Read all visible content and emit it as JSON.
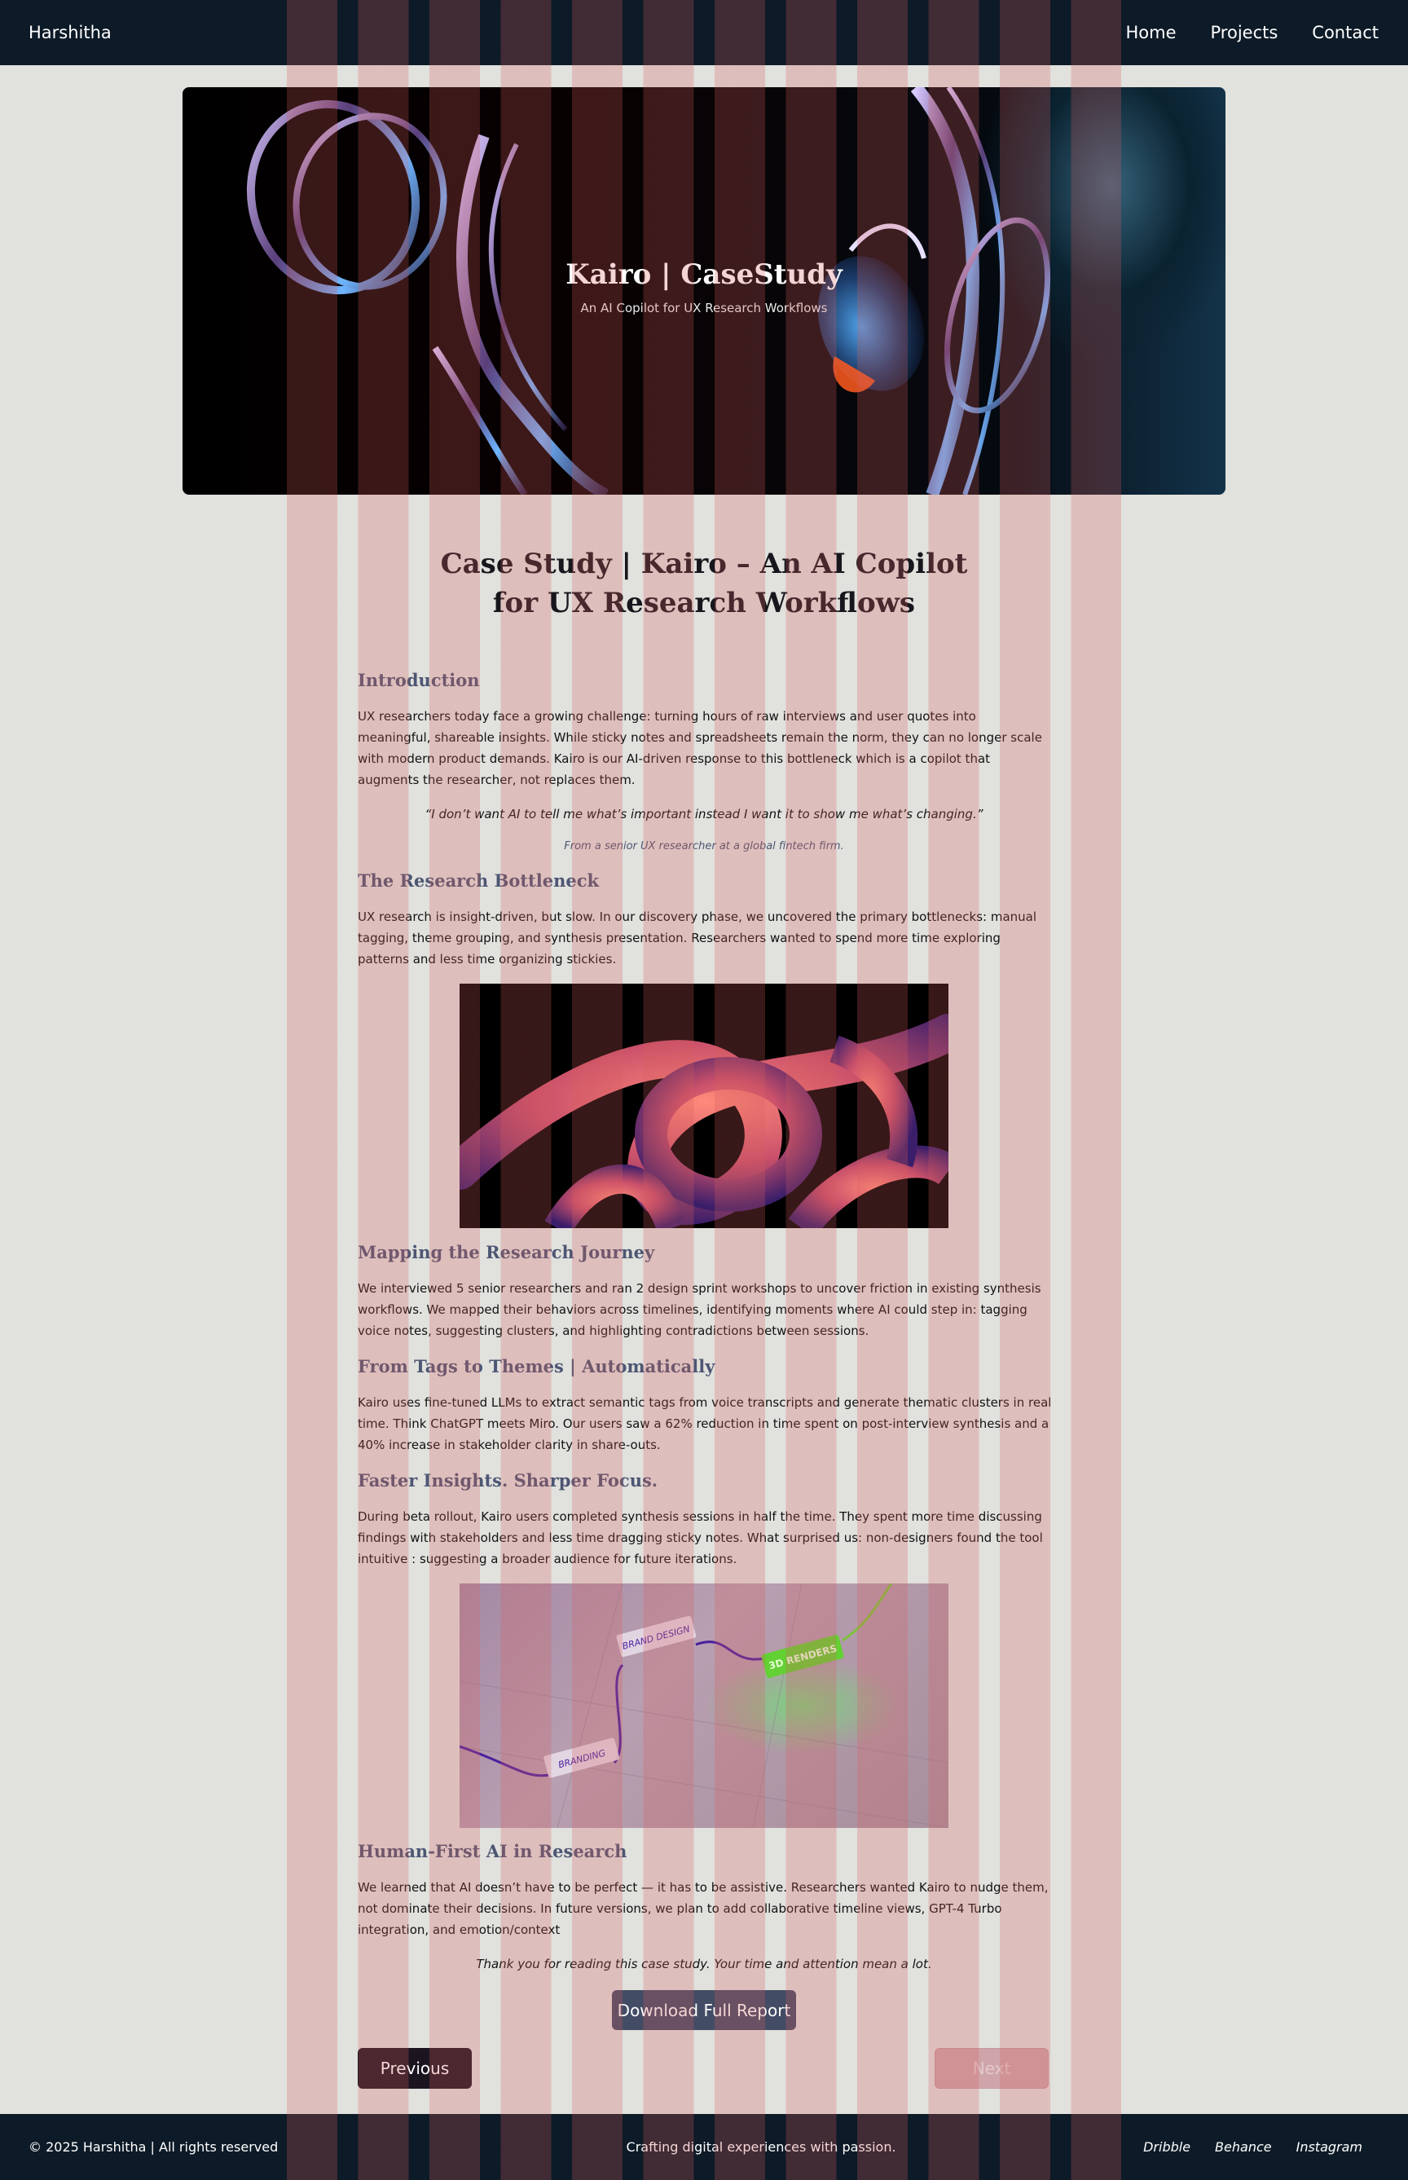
{
  "header": {
    "brand": "Harshitha",
    "nav": [
      "Home",
      "Projects",
      "Contact"
    ]
  },
  "hero": {
    "title": "Kairo | CaseStudy",
    "subtitle": "An AI Copilot for UX Research Workflows"
  },
  "main": {
    "title_line1": "Case Study | Kairo – An AI Copilot",
    "title_line2": "for UX Research Workflows",
    "sections": [
      {
        "heading": "Introduction",
        "body": "UX researchers today face a growing challenge: turning hours of raw interviews and user quotes into meaningful, shareable insights. While sticky notes and spreadsheets remain the norm, they can no longer scale with modern product demands. Kairo is our AI-driven response to this bottleneck which is a copilot that augments the researcher, not replaces them."
      },
      {
        "heading": "The Research Bottleneck",
        "body": "UX research is insight-driven, but slow. In our discovery phase, we uncovered the primary bottlenecks: manual tagging, theme grouping, and synthesis presentation. Researchers wanted to spend more time exploring patterns and less time organizing stickies."
      },
      {
        "heading": "Mapping the Research Journey",
        "body": "We interviewed 5 senior researchers and ran 2 design sprint workshops to uncover friction in existing synthesis workflows. We mapped their behaviors across timelines, identifying moments where AI could step in: tagging voice notes, suggesting clusters, and highlighting contradictions between sessions."
      },
      {
        "heading": "From Tags to Themes | Automatically",
        "body": "Kairo uses fine-tuned LLMs to extract semantic tags from voice transcripts and generate thematic clusters in real time. Think ChatGPT meets Miro. Our users saw a 62% reduction in time spent on post-interview synthesis and a 40% increase in stakeholder clarity in share-outs."
      },
      {
        "heading": "Faster Insights. Sharper Focus.",
        "body": "During beta rollout, Kairo users completed synthesis sessions in half the time. They spent more time discussing findings with stakeholders and less time dragging sticky notes. What surprised us: non-designers found the tool intuitive : suggesting a broader audience for future iterations."
      },
      {
        "heading": "Human-First AI in Research",
        "body": "We learned that AI doesn’t have to be perfect — it has to be assistive. Researchers wanted Kairo to nudge them, not dominate their decisions. In future versions, we plan to add collaborative timeline views, GPT-4 Turbo integration, and emotion/context"
      }
    ],
    "quote": "“I don’t want AI to tell me what’s important instead I want it to show me what’s changing.”",
    "quote_source": "From a senior UX researcher at a global fintech firm.",
    "image2_tags": [
      "BRAND DESIGN",
      "3D RENDERS",
      "BRANDING"
    ],
    "thanks": "Thank you for reading this case study. Your time and attention mean a lot.",
    "download_label": "Download Full Report",
    "prev_label": "Previous",
    "next_label": "Next"
  },
  "footer": {
    "copyright": "© 2025 Harshitha | All rights reserved",
    "tagline": "Crafting digital experiences with passion.",
    "links": [
      "Dribble",
      "Behance",
      "Instagram"
    ]
  },
  "colors": {
    "header_bg": "#0d1a27",
    "page_bg": "#e1e1dd",
    "section_heading": "#4d5673",
    "download_button": "#434c65",
    "previous_button": "#1b1520"
  }
}
